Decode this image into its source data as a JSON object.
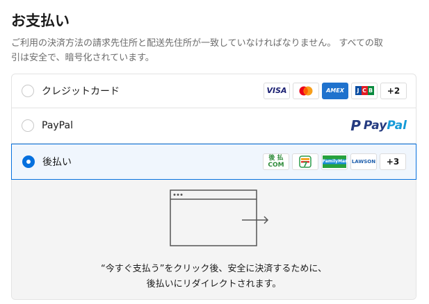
{
  "header": {
    "title": "お支払い",
    "description_line1": "ご利用の決済方法の請求先住所と配送先住所が一致していなければなりません。 すべての取",
    "description_line2": "引は安全で、暗号化されています。"
  },
  "options": [
    {
      "label": "クレジットカード",
      "selected": false,
      "logos": [
        "VISA",
        "Mastercard",
        "AMEX",
        "JCB"
      ],
      "more": "+2"
    },
    {
      "label": "PayPal",
      "selected": false,
      "logo_text_a": "Pay",
      "logo_text_b": "Pal",
      "logo_mark": "P"
    },
    {
      "label": "後払い",
      "selected": true,
      "logos": [
        "後払いcom",
        "7-Eleven",
        "FamilyMart",
        "LAWSON"
      ],
      "more": "+3"
    }
  ],
  "logo_text": {
    "visa": "VISA",
    "amex": "AMEX",
    "atobarai_top": "後 払",
    "atobarai_bottom": "COM",
    "seven": "7",
    "famima": "FamilyMart",
    "lawson": "LAWSON"
  },
  "panel": {
    "line1": "“今すぐ支払う”をクリック後、安全に決済するために、",
    "line2": "後払いにリダイレクトされます。"
  },
  "colors": {
    "accent": "#0570de",
    "selected_bg": "#f0f6fd",
    "panel_bg": "#f4f4f4"
  }
}
